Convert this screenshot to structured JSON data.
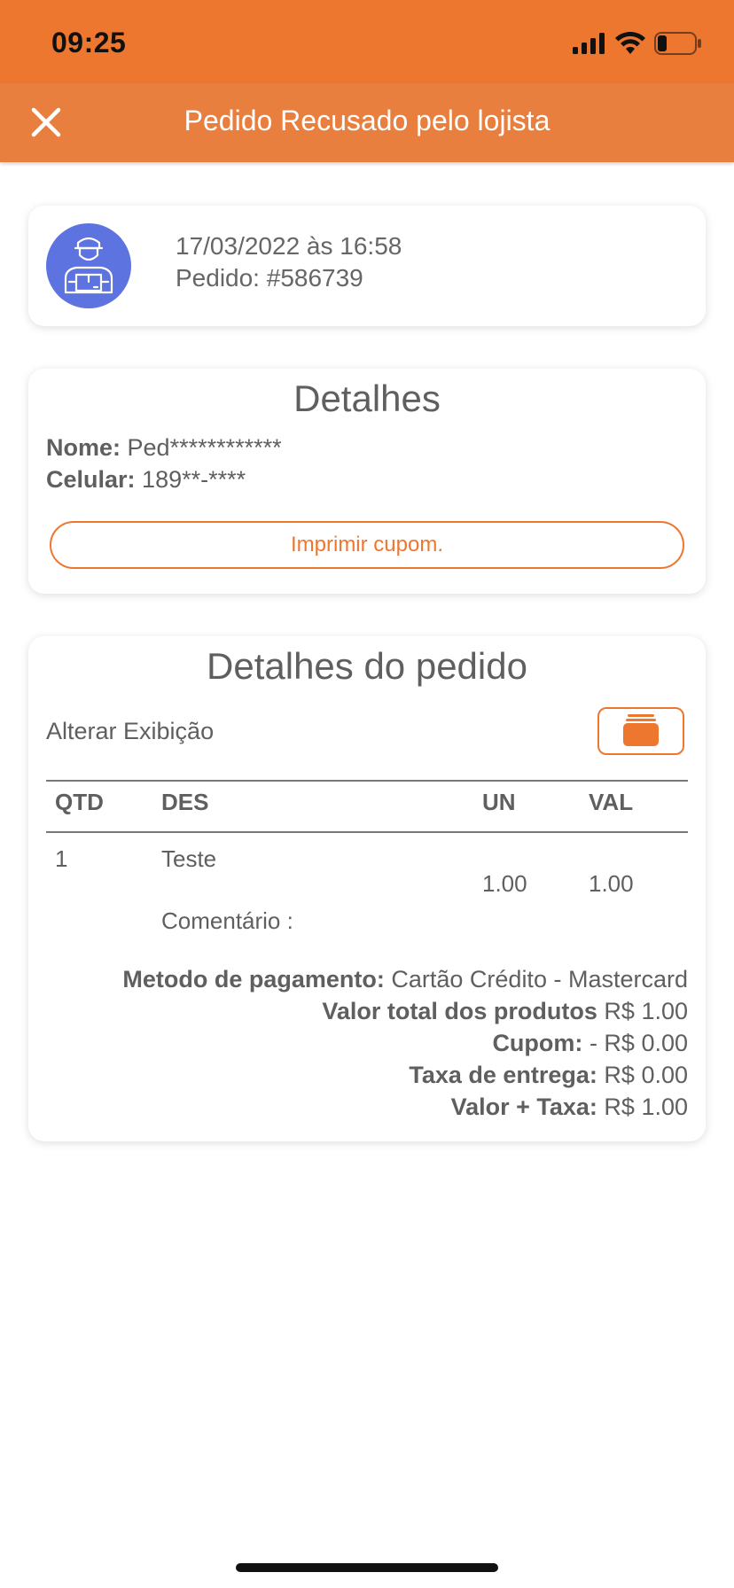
{
  "status_bar": {
    "time": "09:25"
  },
  "header": {
    "title": "Pedido Recusado pelo lojista",
    "accent_color": "#ee7730"
  },
  "order_card": {
    "datetime": "17/03/2022 às 16:58",
    "order_number": "Pedido: #586739",
    "avatar_icon": "delivery-person-icon"
  },
  "details": {
    "title": "Detalhes",
    "name_label": "Nome:",
    "name_value": "Ped************",
    "phone_label": "Celular:",
    "phone_value": "189**-****",
    "print_button": "Imprimir cupom."
  },
  "order_details": {
    "title": "Detalhes do pedido",
    "change_view_label": "Alterar Exibição",
    "view_icon": "card-stack-icon",
    "columns": [
      "QTD",
      "DES",
      "UN",
      "VAL"
    ],
    "rows": [
      {
        "qtd": "1",
        "des": "Teste",
        "un": "1.00",
        "val": "1.00",
        "comment": "Comentário :"
      }
    ],
    "summary": {
      "payment_label": "Metodo de pagamento:",
      "payment_value": "Cartão Crédito - Mastercard",
      "total_products_label": "Valor total dos produtos",
      "total_products_value": "R$ 1.00",
      "coupon_label": "Cupom:",
      "coupon_value": "- R$ 0.00",
      "delivery_fee_label": "Taxa de entrega:",
      "delivery_fee_value": "R$ 0.00",
      "value_plus_fee_label": "Valor + Taxa:",
      "value_plus_fee_value": "R$ 1.00"
    }
  }
}
